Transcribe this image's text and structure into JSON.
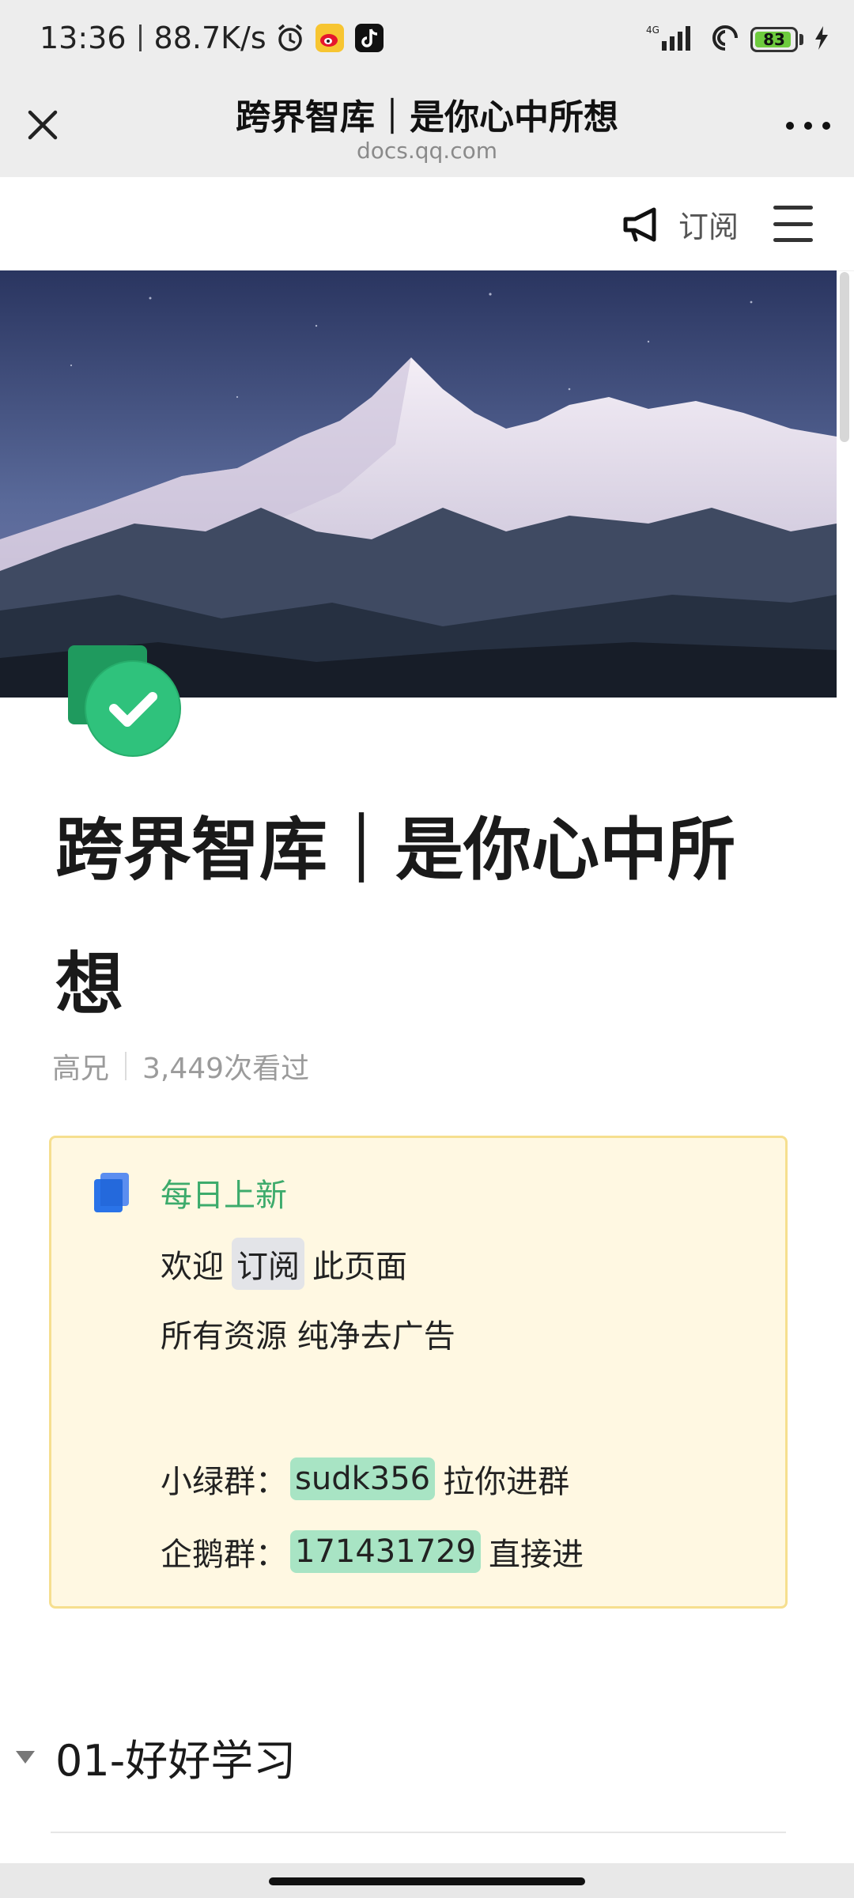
{
  "status_bar": {
    "time": "13:36",
    "speed": "88.7K/s",
    "network": "4G",
    "battery": "83",
    "icons": [
      "alarm-icon",
      "weibo-icon",
      "tiktok-icon",
      "signal-icon",
      "hotspot-icon",
      "battery-icon",
      "charging-icon"
    ]
  },
  "title_bar": {
    "title": "跨界智库｜是你心中所想",
    "url": "docs.qq.com"
  },
  "page_header": {
    "subscribe_label": "订阅"
  },
  "doc": {
    "title": "跨界智库｜是你心中所想",
    "author": "高兄",
    "views": "3,449次看过"
  },
  "callout": {
    "title": "每日上新",
    "line1_before": "欢迎",
    "line1_highlight": "订阅",
    "line1_after": "此页面",
    "line2": "所有资源 纯净去广告",
    "line3_label": "小绿群：",
    "line3_value": "sudk356",
    "line3_after": "拉你进群",
    "line4_label": "企鹅群：",
    "line4_value": "171431729",
    "line4_after": "直接进"
  },
  "section": {
    "label": "01-好好学习"
  },
  "colors": {
    "callout_bg": "#fff8e2",
    "callout_border": "#f6df8f",
    "callout_title": "#3dab6c",
    "highlight_green": "#a8e4c4",
    "highlight_gray": "#e3e4e8"
  }
}
